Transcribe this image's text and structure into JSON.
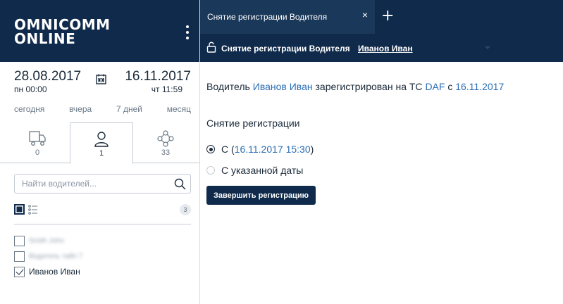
{
  "brand": {
    "line1": "OMNICOMM",
    "line2": "ONLINE"
  },
  "period": {
    "from_date": "28.08.2017",
    "from_time": "пн 00:00",
    "to_date": "16.11.2017",
    "to_time": "чт 11:59",
    "ranges": [
      "сегодня",
      "вчера",
      "7 дней",
      "месяц"
    ]
  },
  "object_tabs": [
    {
      "icon": "truck-icon",
      "count": "0"
    },
    {
      "icon": "person-icon",
      "count": "1"
    },
    {
      "icon": "group-icon",
      "count": "33"
    }
  ],
  "search": {
    "placeholder": "Найти водителей..."
  },
  "list": {
    "count": "3",
    "items": [
      {
        "label": "Smith John",
        "checked": false,
        "obscured": true
      },
      {
        "label": "Водитель тайп 7",
        "checked": false,
        "obscured": true
      },
      {
        "label": "Иванов Иван",
        "checked": true,
        "obscured": false
      }
    ]
  },
  "tabbar": {
    "tab_label": "Снятие регистрации Водителя",
    "close": "×",
    "add": "+"
  },
  "subbar": {
    "title": "Снятие регистрации Водителя",
    "driver": "Иванов Иван"
  },
  "content": {
    "info_prefix": "Водитель",
    "driver_name": "Иванов Иван",
    "info_mid": "зарегистрирован на ТС",
    "vehicle": "DAF",
    "info_c": "с",
    "reg_date": "16.11.2017",
    "section_title": "Снятие регистрации",
    "option1_prefix": "С (",
    "option1_date": "16.11.2017 15:30",
    "option1_suffix": ")",
    "option2_label": "С указанной даты",
    "submit_label": "Завершить регистрацию"
  },
  "colors": {
    "navy": "#0f2a4a",
    "link": "#2d6fb4",
    "muted": "#6a7886"
  }
}
